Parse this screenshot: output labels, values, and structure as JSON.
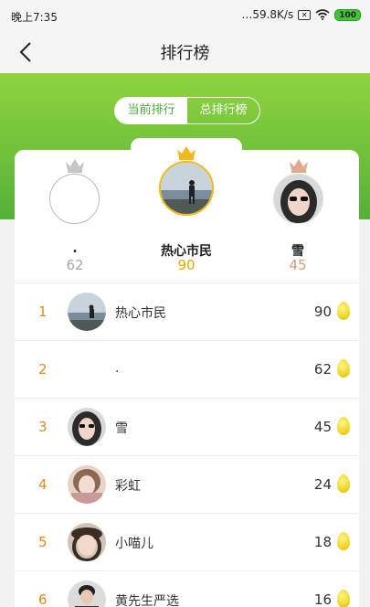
{
  "status_bar": {
    "time": "晚上7:35",
    "network_speed": "…59.8K/s",
    "battery": "100"
  },
  "header": {
    "title": "排行榜"
  },
  "tabs": [
    {
      "label": "当前排行",
      "active": true
    },
    {
      "label": "总排行榜",
      "active": false
    }
  ],
  "podium": {
    "second": {
      "name": ".",
      "score": "62",
      "crown_color": "#c6c6c6",
      "score_color": "#a8a8a8"
    },
    "first": {
      "name": "热心市民",
      "score": "90",
      "crown_color": "#f2b81a",
      "score_color": "#e8a800"
    },
    "third": {
      "name": "雪",
      "score": "45",
      "crown_color": "#e2a98f",
      "score_color": "#d49a80"
    }
  },
  "ranking": [
    {
      "rank": "1",
      "name": "热心市民",
      "score": "90",
      "avatar": "coast-photo"
    },
    {
      "rank": "2",
      "name": ".",
      "score": "62",
      "avatar": "none"
    },
    {
      "rank": "3",
      "name": "雪",
      "score": "45",
      "avatar": "girl-sunglasses"
    },
    {
      "rank": "4",
      "name": "彩虹",
      "score": "24",
      "avatar": "girl-photo"
    },
    {
      "rank": "5",
      "name": "小喵儿",
      "score": "18",
      "avatar": "girl-hat"
    },
    {
      "rank": "6",
      "name": "黄先生严选",
      "score": "16",
      "avatar": "man-photo"
    }
  ],
  "colors": {
    "accent_green": "#56b13a",
    "rank_orange": "#e08a23",
    "egg_yellow": "#f0d728"
  }
}
